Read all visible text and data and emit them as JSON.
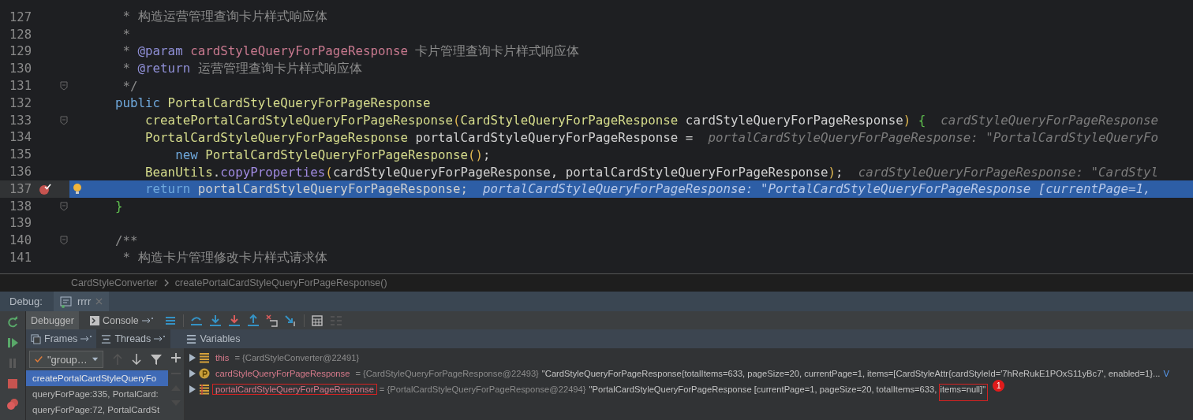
{
  "editor": {
    "lines": [
      {
        "number": "127",
        "current": false,
        "fold": false,
        "breakpoint": false,
        "bulb": false,
        "segments": [
          {
            "kind": "comment",
            "text": "     * 构造运营管理查询卡片样式响应体"
          }
        ]
      },
      {
        "number": "128",
        "current": false,
        "fold": false,
        "breakpoint": false,
        "bulb": false,
        "segments": [
          {
            "kind": "comment",
            "text": "     *"
          }
        ]
      },
      {
        "number": "129",
        "current": false,
        "fold": false,
        "breakpoint": false,
        "bulb": false,
        "segments": [
          {
            "kind": "comment",
            "text": "     * "
          },
          {
            "kind": "doctag",
            "text": "@param"
          },
          {
            "kind": "docparam",
            "text": " cardStyleQueryForPageResponse"
          },
          {
            "kind": "comment",
            "text": " 卡片管理查询卡片样式响应体"
          }
        ]
      },
      {
        "number": "130",
        "current": false,
        "fold": false,
        "breakpoint": false,
        "bulb": false,
        "segments": [
          {
            "kind": "comment",
            "text": "     * "
          },
          {
            "kind": "doctag",
            "text": "@return"
          },
          {
            "kind": "comment",
            "text": " 运营管理查询卡片样式响应体"
          }
        ]
      },
      {
        "number": "131",
        "current": false,
        "fold": true,
        "breakpoint": false,
        "bulb": false,
        "segments": [
          {
            "kind": "comment",
            "text": "     */"
          }
        ]
      },
      {
        "number": "132",
        "current": false,
        "fold": false,
        "breakpoint": false,
        "bulb": false,
        "segments": [
          {
            "kind": "keyword",
            "text": "    public"
          },
          {
            "kind": "type",
            "text": " PortalCardStyleQueryForPageResponse"
          }
        ]
      },
      {
        "number": "133",
        "current": false,
        "fold": true,
        "breakpoint": false,
        "bulb": false,
        "segments": [
          {
            "kind": "type",
            "text": "        createPortalCardStyleQueryForPageResponse"
          },
          {
            "kind": "paren",
            "text": "("
          },
          {
            "kind": "type",
            "text": "CardStyleQueryForPageResponse"
          },
          {
            "kind": "plain",
            "text": " cardStyleQueryForPageResponse"
          },
          {
            "kind": "paren",
            "text": ")"
          },
          {
            "kind": "brace",
            "text": " {"
          }
        ],
        "hint": "cardStyleQueryForPageResponse"
      },
      {
        "number": "134",
        "current": false,
        "fold": false,
        "breakpoint": false,
        "bulb": false,
        "segments": [
          {
            "kind": "type",
            "text": "        PortalCardStyleQueryForPageResponse"
          },
          {
            "kind": "plain",
            "text": " portalCardStyleQueryForPageResponse ="
          }
        ],
        "hint": "portalCardStyleQueryForPageResponse: \"PortalCardStyleQueryFo"
      },
      {
        "number": "135",
        "current": false,
        "fold": false,
        "breakpoint": false,
        "bulb": false,
        "segments": [
          {
            "kind": "keyword",
            "text": "            new"
          },
          {
            "kind": "type",
            "text": " PortalCardStyleQueryForPageResponse"
          },
          {
            "kind": "paren",
            "text": "()"
          },
          {
            "kind": "plain",
            "text": ";"
          }
        ]
      },
      {
        "number": "136",
        "current": false,
        "fold": false,
        "breakpoint": false,
        "bulb": false,
        "segments": [
          {
            "kind": "type",
            "text": "        BeanUtils"
          },
          {
            "kind": "plain",
            "text": "."
          },
          {
            "kind": "member",
            "text": "copyProperties"
          },
          {
            "kind": "paren",
            "text": "("
          },
          {
            "kind": "plain",
            "text": "cardStyleQueryForPageResponse, portalCardStyleQueryForPageResponse"
          },
          {
            "kind": "paren",
            "text": ")"
          },
          {
            "kind": "plain",
            "text": ";"
          }
        ],
        "hint": "cardStyleQueryForPageResponse: \"CardStyl"
      },
      {
        "number": "137",
        "current": true,
        "fold": false,
        "breakpoint": true,
        "bulb": true,
        "segments": [
          {
            "kind": "keyword",
            "text": "        return"
          },
          {
            "kind": "plain",
            "text": " portalCardStyleQueryForPageResponse;"
          }
        ],
        "hint": "portalCardStyleQueryForPageResponse: \"PortalCardStyleQueryForPageResponse [currentPage=1,"
      },
      {
        "number": "138",
        "current": false,
        "fold": true,
        "breakpoint": false,
        "bulb": false,
        "segments": [
          {
            "kind": "brace",
            "text": "    }"
          }
        ]
      },
      {
        "number": "139",
        "current": false,
        "fold": false,
        "breakpoint": false,
        "bulb": false
      },
      {
        "number": "140",
        "current": false,
        "fold": true,
        "breakpoint": false,
        "bulb": false,
        "segments": [
          {
            "kind": "comment",
            "text": "    /**"
          }
        ]
      },
      {
        "number": "141",
        "current": false,
        "fold": false,
        "breakpoint": false,
        "bulb": false,
        "segments": [
          {
            "kind": "comment",
            "text": "     * 构造卡片管理修改卡片样式请求体"
          }
        ]
      }
    ]
  },
  "breadcrumbs": [
    "CardStyleConverter",
    "createPortalCardStyleQueryForPageResponse()"
  ],
  "debug": {
    "label": "Debug:",
    "session": "rrrr",
    "tabs": [
      {
        "label": "Debugger",
        "selected": true
      },
      {
        "label": "Console",
        "selected": false
      }
    ],
    "frames_header": "Frames",
    "threads_header": "Threads",
    "variables_header": "Variables",
    "thread_dropdown": "\"group…",
    "frames": [
      {
        "label": "createPortalCardStyleQueryFo",
        "selected": true
      },
      {
        "label": "queryForPage:335, PortalCard:",
        "selected": false
      },
      {
        "label": "queryForPage:72, PortalCardSt",
        "selected": false
      }
    ],
    "variables": [
      {
        "kind": "field",
        "name": "this",
        "ref": "= {CardStyleConverter@22491}",
        "annotated": false
      },
      {
        "kind": "param",
        "name": "cardStyleQueryForPageResponse",
        "ref": "= {CardStyleQueryForPageResponse@22493}",
        "value": "\"CardStyleQueryForPageResponse{totalItems=633, pageSize=20, currentPage=1, items=[CardStyleAttr{cardStyleId='7hReRukE1POxS11yBc7', enabled=1}...",
        "link": "V",
        "annotated": false
      },
      {
        "kind": "local",
        "name": "portalCardStyleQueryForPageResponse",
        "ref": "= {PortalCardStyleQueryForPageResponse@22494}",
        "value": "\"PortalCardStyleQueryForPageResponse [currentPage=1, pageSize=20, totalItems=633,",
        "marked_value": " items=null]\"",
        "badge": "1",
        "annotated": true
      }
    ]
  }
}
